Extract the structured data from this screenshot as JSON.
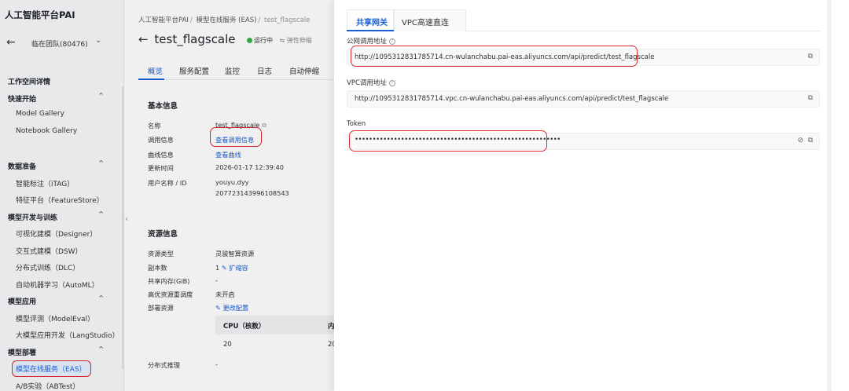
{
  "sidebar": {
    "brand": "人工智能平台PAI",
    "team": "临在团队(80476)",
    "items": [
      {
        "label": "工作空间详情",
        "type": "section",
        "chevron": false
      },
      {
        "label": "快速开始",
        "type": "section",
        "chevron": true
      },
      {
        "label": "Model Gallery",
        "type": "item"
      },
      {
        "label": "Notebook Gallery",
        "type": "item"
      },
      {
        "gap": true
      },
      {
        "label": "数据准备",
        "type": "section",
        "chevron": true
      },
      {
        "label": "智能标注（iTAG）",
        "type": "item"
      },
      {
        "label": "特征平台（FeatureStore）",
        "type": "item"
      },
      {
        "label": "模型开发与训练",
        "type": "section",
        "chevron": true
      },
      {
        "label": "可视化建模（Designer）",
        "type": "item"
      },
      {
        "label": "交互式建模（DSW）",
        "type": "item"
      },
      {
        "label": "分布式训练（DLC）",
        "type": "item"
      },
      {
        "label": "自动机器学习（AutoML）",
        "type": "item"
      },
      {
        "label": "模型应用",
        "type": "section",
        "chevron": true
      },
      {
        "label": "模型评测（ModelEval）",
        "type": "item"
      },
      {
        "label": "大模型应用开发（LangStudio）",
        "type": "item"
      },
      {
        "label": "模型部署",
        "type": "section",
        "chevron": true
      },
      {
        "label": "模型在线服务（EAS）",
        "type": "item",
        "active": true
      },
      {
        "label": "A/B实验（ABTest）",
        "type": "item"
      }
    ]
  },
  "main": {
    "breadcrumb": [
      "人工智能平台PAI",
      "模型在线服务 (EAS)",
      "test_flagscale"
    ],
    "title": "test_flagscale",
    "status": "运行中",
    "scale_label": "弹性伸缩",
    "tabs": [
      "概览",
      "服务配置",
      "监控",
      "日志",
      "自动伸缩"
    ],
    "basic": {
      "title": "基本信息",
      "rows": [
        {
          "k": "名称",
          "v": "test_flagscale"
        },
        {
          "k": "调用信息",
          "v": "查看调用信息"
        },
        {
          "k": "曲线信息",
          "v": "查看曲线"
        },
        {
          "k": "更新时间",
          "v": "2026-01-17 12:39:40"
        },
        {
          "k": "用户名称 / ID",
          "v": "youyu.dyy"
        },
        {
          "k": "",
          "v": "207723143996108543"
        }
      ]
    },
    "resource": {
      "title": "资源信息",
      "rows": [
        {
          "k": "资源类型",
          "v": "灵骏智算资源"
        },
        {
          "k": "副本数",
          "v": "1",
          "link": "扩缩容"
        },
        {
          "k": "共享内存(GiB)",
          "v": "-"
        },
        {
          "k": "高优资源重调度",
          "v": "未开启"
        },
        {
          "k": "部署资源",
          "v": "",
          "link": "更改配置"
        }
      ],
      "table_headers": [
        "CPU（核数）",
        "内"
      ],
      "table_values": [
        "20",
        "20"
      ],
      "distributed_label": "分布式推理",
      "distributed_value": "-"
    }
  },
  "drawer": {
    "tabs": [
      "共享网关",
      "VPC高速直连"
    ],
    "public_label": "公网调用地址",
    "public_url": "http://1095312831785714.cn-wulanchabu.pai-eas.aliyuncs.com/api/predict/test_flagscale",
    "vpc_label": "VPC调用地址",
    "vpc_url": "http://1095312831785714.vpc.cn-wulanchabu.pai-eas.aliyuncs.com/api/predict/test_flagscale",
    "token_label": "Token",
    "token_value": "••••••••••••••••••••••••••••••••••••••••••••••••••••••••••"
  },
  "colors": {
    "accent": "#1a5fd6",
    "highlight": "#e0292f",
    "running": "#35b34a"
  }
}
